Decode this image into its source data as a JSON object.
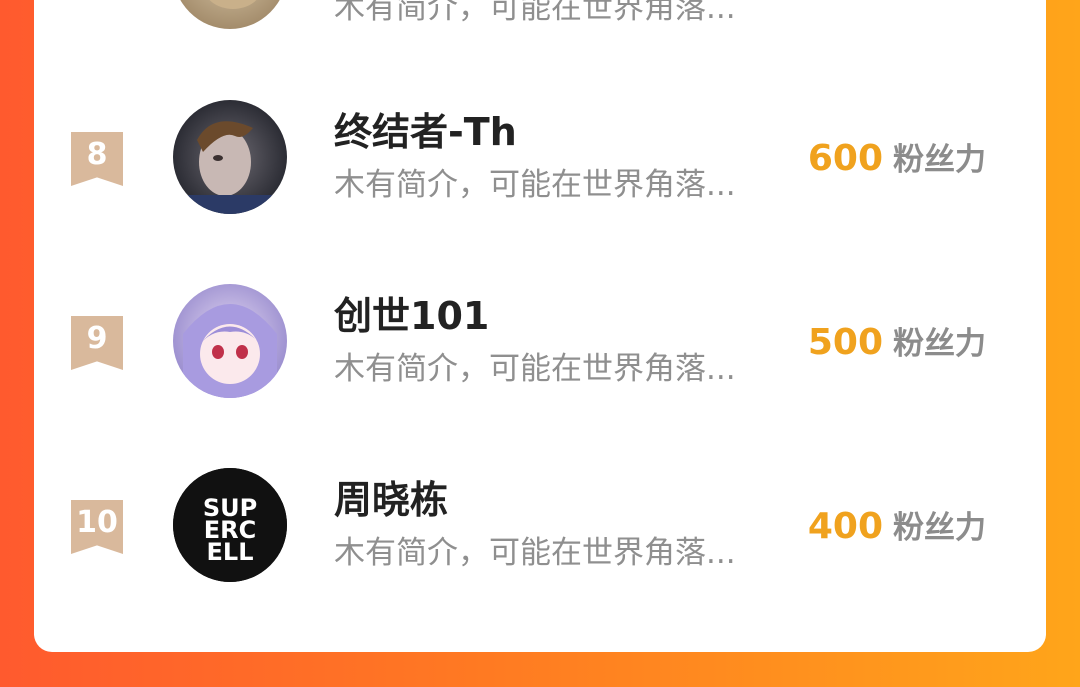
{
  "leaderboard": {
    "rows": [
      {
        "rank": "",
        "name": "",
        "bio": "木有简介，可能在世界角落...",
        "score": "",
        "unit": ""
      },
      {
        "rank": "8",
        "name": "终结者-Th",
        "bio": "木有简介，可能在世界角落...",
        "score": "600",
        "unit": "粉丝力"
      },
      {
        "rank": "9",
        "name": "创世101",
        "bio": "木有简介，可能在世界角落...",
        "score": "500",
        "unit": "粉丝力"
      },
      {
        "rank": "10",
        "name": "周晓栋",
        "bio": "木有简介，可能在世界角落...",
        "score": "400",
        "unit": "粉丝力"
      }
    ]
  },
  "colors": {
    "accent": "#f0a21e",
    "rank_badge": "#d9b99c",
    "background_start": "#ff5a2e",
    "background_end": "#ffa51a"
  },
  "avatars": [
    {
      "icon": "user-avatar-photo"
    },
    {
      "icon": "user-avatar-photo"
    },
    {
      "icon": "user-avatar-anime"
    },
    {
      "icon": "supercell-logo-avatar",
      "logo_text": [
        "SUP",
        "ERC",
        "ELL"
      ]
    }
  ]
}
